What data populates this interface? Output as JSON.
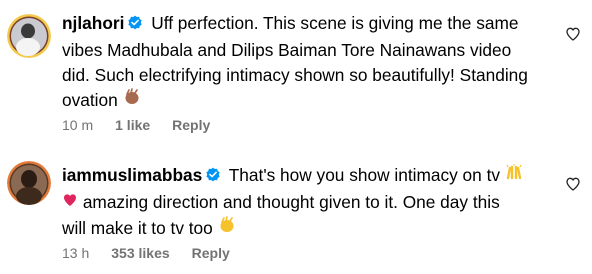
{
  "colors": {
    "verified": "#0095f6",
    "meta_text": "#737373",
    "heart_emoji": "#e0245e"
  },
  "comments": [
    {
      "username": "njlahori",
      "text_lines": [
        "Uff perfection. This scene is giving me the same",
        "vibes Madhubala and Dilips Baiman Tore Nainawans video",
        "did. Such electrifying intimacy shown so beautifully! Standing",
        "ovation"
      ],
      "emoji_end": "clapping-hands-medium-skin",
      "time": "10 m",
      "likes": "1 like",
      "reply": "Reply"
    },
    {
      "username": "iammuslimabbas",
      "text_lines": [
        "That's how you show intimacy on tv",
        "amazing direction and thought given to it. One day this",
        "will make it to tv too"
      ],
      "emoji_a": "raising-hands",
      "emoji_b": "red-heart",
      "emoji_end": "clapping-hands",
      "time": "13 h",
      "likes": "353 likes",
      "reply": "Reply"
    }
  ]
}
